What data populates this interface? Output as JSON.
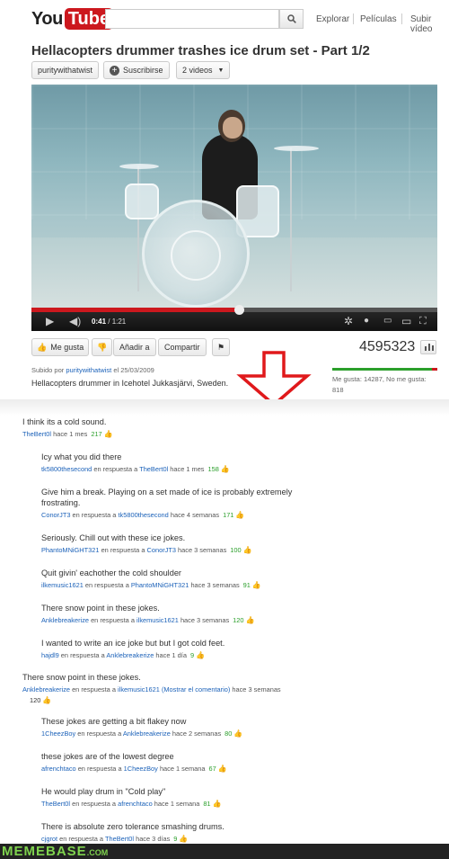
{
  "header": {
    "logo_you": "You",
    "logo_tube": "Tube",
    "search": {
      "placeholder": ""
    },
    "nav": [
      "Explorar",
      "Películas",
      "Subir vídeo"
    ]
  },
  "video": {
    "title": "Hellacopters drummer trashes ice drum set - Part 1/2",
    "channel": "puritywithatwist",
    "subscribe": "Suscribirse",
    "videos_dropdown": "2 videos",
    "time_current": "0:41",
    "time_total": "1:21",
    "progress": 0.51
  },
  "actions": {
    "like": "Me gusta",
    "add_to": "Añadir a",
    "share": "Compartir",
    "views": "4595323",
    "likes_text": "Me gusta: 14287, No me gusta: 818",
    "like_ratio": 0.946
  },
  "upload": {
    "prefix": "Subido por",
    "user": "puritywithatwist",
    "date": "el 25/03/2009",
    "description": "Hellacopters drummer in Icehotel Jukkasjärvi, Sweden."
  },
  "colors": {
    "brand_red": "#cc181e",
    "link_blue": "#1c62b9",
    "score_green": "#2b9f2b",
    "arrow_red": "#e0191b",
    "memebase_green": "#7fd34e"
  },
  "comments": [
    {
      "text": "I think its a cold sound.",
      "user": "TheBert0l",
      "reply_to": "",
      "extra": "",
      "time": "hace 1 mes",
      "score": "217"
    },
    {
      "text": "Icy what you did there",
      "user": "tk5800thesecond",
      "reply_to": "TheBert0l",
      "extra": "",
      "time": "hace 1 mes",
      "score": "158"
    },
    {
      "text": "Give him a break. Playing on a set made of ice is probably extremely frostrating.",
      "user": "ConorJT3",
      "reply_to": "tk5800thesecond",
      "extra": "",
      "time": "hace 4 semanas",
      "score": "171"
    },
    {
      "text": "Seriously. Chill out with these ice jokes.",
      "user": "PhantoMNiGHT321",
      "reply_to": "ConorJT3",
      "extra": "",
      "time": "hace 3 semanas",
      "score": "100"
    },
    {
      "text": "Quit givin' eachother the cold shoulder",
      "user": "ilkemusic1621",
      "reply_to": "PhantoMNiGHT321",
      "extra": "",
      "time": "hace 3 semanas",
      "score": "91"
    },
    {
      "text": "There snow point in these jokes.",
      "user": "Anklebreakerize",
      "reply_to": "ilkemusic1621",
      "extra": "",
      "time": "hace 3 semanas",
      "score": "120"
    },
    {
      "text": "I wanted to write an ice joke but but I got cold feet.",
      "user": "hajdl9",
      "reply_to": "Anklebreakerize",
      "extra": "",
      "time": "hace 1 día",
      "score": "9"
    },
    {
      "text": "There snow point in these jokes.",
      "user": "Anklebreakerize",
      "reply_to": "ilkemusic1621",
      "extra": "(Mostrar el comentario)",
      "time": "hace 3 semanas",
      "score": "120"
    },
    {
      "text": "These jokes are getting a bit flakey now",
      "user": "1CheezBoy",
      "reply_to": "Anklebreakerize",
      "extra": "",
      "time": "hace 2 semanas",
      "score": "80"
    },
    {
      "text": "these jokes are of the lowest degree",
      "user": "afrenchtaco",
      "reply_to": "1CheezBoy",
      "extra": "",
      "time": "hace 1 semana",
      "score": "67"
    },
    {
      "text": "He would play drum in \"Cold play\"",
      "user": "TheBert0l",
      "reply_to": "afrenchtaco",
      "extra": "",
      "time": "hace 1 semana",
      "score": "81"
    },
    {
      "text": "There is absolute zero tolerance smashing drums.",
      "user": "cjgrot",
      "reply_to": "TheBert0l",
      "extra": "",
      "time": "hace 3 días",
      "score": "9"
    }
  ],
  "labels": {
    "in_reply_to": "en respuesta a"
  },
  "footer": {
    "brand": "MEMEBASE",
    "domain": ".COM"
  }
}
